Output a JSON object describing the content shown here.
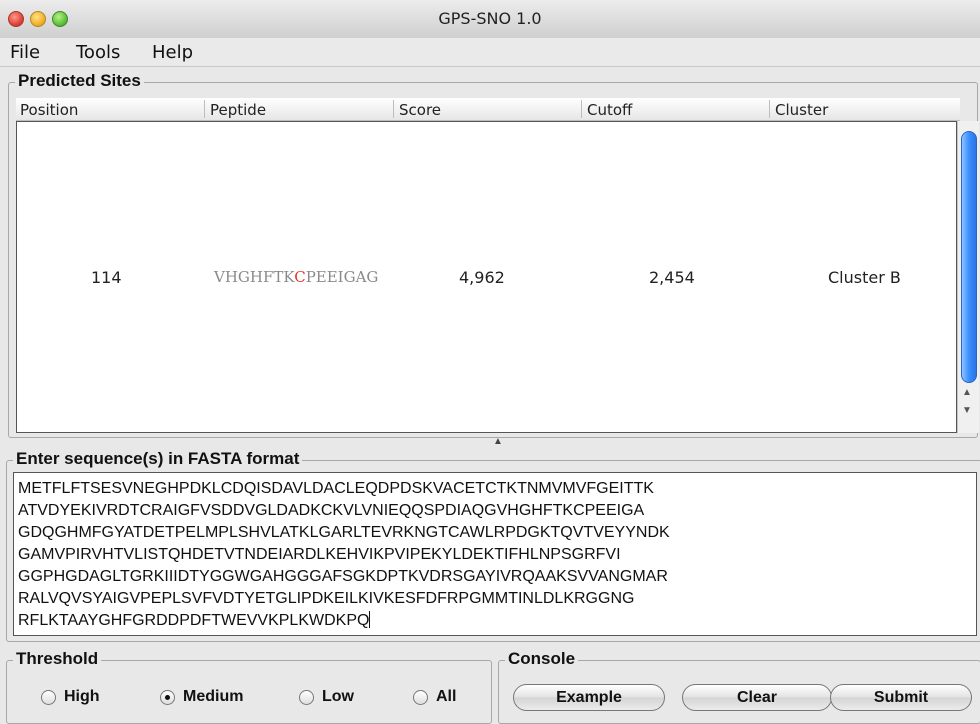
{
  "window": {
    "title": "GPS-SNO 1.0"
  },
  "menubar": {
    "items": [
      "File",
      "Tools",
      "Help"
    ]
  },
  "predicted_sites": {
    "title": "Predicted Sites",
    "columns": [
      "Position",
      "Peptide",
      "Score",
      "Cutoff",
      "Cluster"
    ],
    "rows": [
      {
        "position": "114",
        "peptide_before": "VHGHFTK",
        "peptide_site": "C",
        "peptide_after": "PEEIGAG",
        "score": "4,962",
        "cutoff": "2,454",
        "cluster": "Cluster B"
      }
    ]
  },
  "fasta": {
    "title": "Enter sequence(s) in FASTA format",
    "lines": [
      "METFLFTSESVNEGHPDKLCDQISDAVLDACLEQDPDSKVACETCTKTNMVMVFGEITTK",
      "ATVDYEKIVRDTCRAIGFVSDDVGLDADKCKVLVNIEQQSPDIAQGVHGHFTKCPEEIGA",
      "GDQGHMFGYATDETPELMPLSHVLATKLGARLTEVRKNGTCAWLRPDGKTQVTVEYYNDK",
      "GAMVPIRVHTVLISTQHDETVTNDEIARDLKEHVIKPVIPEKYLDEKTIFHLNPSGRFVI",
      "GGPHGDAGLTGRKIIIDTYGGWGAHGGGAFSGKDPTKVDRSGAYIVRQAAKSVVANGMAR",
      "RALVQVSYAIGVPEPLSVFVDTYETGLIPDKEILKIVKESFDFRPGMMTINLDLKRGGNG",
      "RFLKTAAYGHFGRDDPDFTWEVVKPLKWDKPQ"
    ]
  },
  "threshold": {
    "title": "Threshold",
    "options": [
      "High",
      "Medium",
      "Low",
      "All"
    ],
    "selected": "Medium"
  },
  "console": {
    "title": "Console",
    "buttons": [
      "Example",
      "Clear",
      "Submit"
    ]
  },
  "colors": {
    "site_highlight": "#e03a2a",
    "scrollbar": "#3b8eff"
  }
}
